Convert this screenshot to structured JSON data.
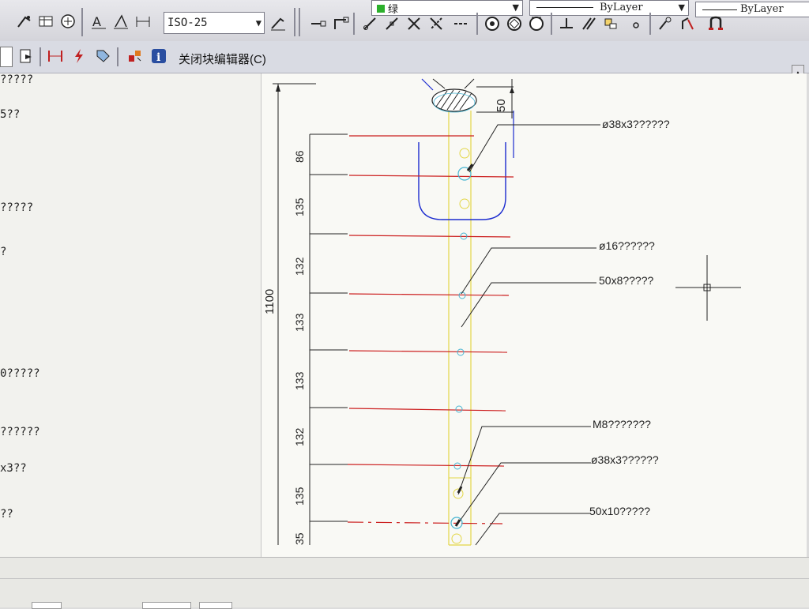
{
  "toolbar": {
    "dimstyle_value": "ISO-25",
    "layer_value": "绿",
    "linetype_value": "ByLayer",
    "lineweight_value": "ByLayer"
  },
  "block_editor": {
    "close_label": "关闭块编辑器(C)"
  },
  "left_panel": {
    "rows": [
      "?????",
      "5??",
      "?????",
      "?",
      "0?????",
      "??????",
      "x3??",
      "??"
    ]
  },
  "drawing": {
    "dims": {
      "overall": "1100",
      "top": "50",
      "segments": [
        "86",
        "135",
        "132",
        "133",
        "133",
        "132",
        "135",
        "35"
      ]
    },
    "labels": {
      "pipe_top": "ø38x3??????",
      "rod": "ø16??????",
      "plate_8": "50x8?????",
      "bolt": "M8???????",
      "pipe_bottom": "ø38x3??????",
      "plate_10": "50x10?????"
    }
  },
  "colors": {
    "dim": "#222222",
    "center_line": "#cc1f1f",
    "outline": "#e3d646",
    "hole": "#46b4d2",
    "boundary": "#1c2ccf"
  }
}
